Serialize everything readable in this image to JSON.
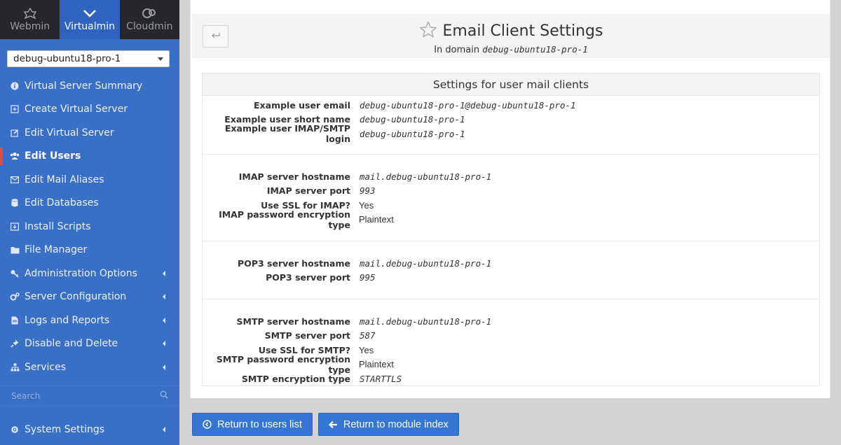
{
  "nav": {
    "tabs": [
      {
        "label": "Webmin",
        "icon": "webmin-icon"
      },
      {
        "label": "Virtualmin",
        "icon": "virtualmin-icon"
      },
      {
        "label": "Cloudmin",
        "icon": "cloudmin-icon"
      }
    ],
    "active_tab": "Virtualmin"
  },
  "sidebar": {
    "domain": "debug-ubuntu18-pro-1",
    "items": [
      {
        "label": "Virtual Server Summary",
        "icon": "info-icon"
      },
      {
        "label": "Create Virtual Server",
        "icon": "plus-square-icon"
      },
      {
        "label": "Edit Virtual Server",
        "icon": "edit-icon"
      },
      {
        "label": "Edit Users",
        "icon": "users-icon"
      },
      {
        "label": "Edit Mail Aliases",
        "icon": "envelope-icon"
      },
      {
        "label": "Edit Databases",
        "icon": "database-icon"
      },
      {
        "label": "Install Scripts",
        "icon": "download-icon"
      },
      {
        "label": "File Manager",
        "icon": "folder-icon"
      },
      {
        "label": "Administration Options",
        "icon": "key-icon"
      },
      {
        "label": "Server Configuration",
        "icon": "cogs-icon"
      },
      {
        "label": "Logs and Reports",
        "icon": "file-icon"
      },
      {
        "label": "Disable and Delete",
        "icon": "plug-icon"
      },
      {
        "label": "Services",
        "icon": "sitemap-icon"
      }
    ],
    "search_placeholder": "Search",
    "system_settings": "System Settings",
    "accent_color": "#e74c3c"
  },
  "page": {
    "title": "Email Client Settings",
    "subtitle_prefix": "In domain",
    "subtitle_domain": "debug-ubuntu18-pro-1"
  },
  "settings": {
    "title": "Settings for user mail clients",
    "sections": [
      {
        "rows": [
          {
            "label": "Example user email",
            "value": "debug-ubuntu18-pro-1@debug-ubuntu18-pro-1"
          },
          {
            "label": "Example user short name",
            "value": "debug-ubuntu18-pro-1"
          },
          {
            "label": "Example user IMAP/SMTP login",
            "value": "debug-ubuntu18-pro-1"
          }
        ]
      },
      {
        "rows": [
          {
            "label": "IMAP server hostname",
            "value": "mail.debug-ubuntu18-pro-1"
          },
          {
            "label": "IMAP server port",
            "value": "993"
          },
          {
            "label": "Use SSL for IMAP?",
            "value": "Yes"
          },
          {
            "label": "IMAP password encryption type",
            "value": "Plaintext"
          }
        ]
      },
      {
        "rows": [
          {
            "label": "POP3 server hostname",
            "value": "mail.debug-ubuntu18-pro-1"
          },
          {
            "label": "POP3 server port",
            "value": "995"
          }
        ]
      },
      {
        "rows": [
          {
            "label": "SMTP server hostname",
            "value": "mail.debug-ubuntu18-pro-1"
          },
          {
            "label": "SMTP server port",
            "value": "587"
          },
          {
            "label": "Use SSL for SMTP?",
            "value": "Yes"
          },
          {
            "label": "SMTP password encryption type",
            "value": "Plaintext"
          },
          {
            "label": "SMTP encryption type",
            "value": "STARTTLS"
          }
        ]
      }
    ]
  },
  "buttons": {
    "return_users": "Return to users list",
    "return_module": "Return to module index"
  }
}
